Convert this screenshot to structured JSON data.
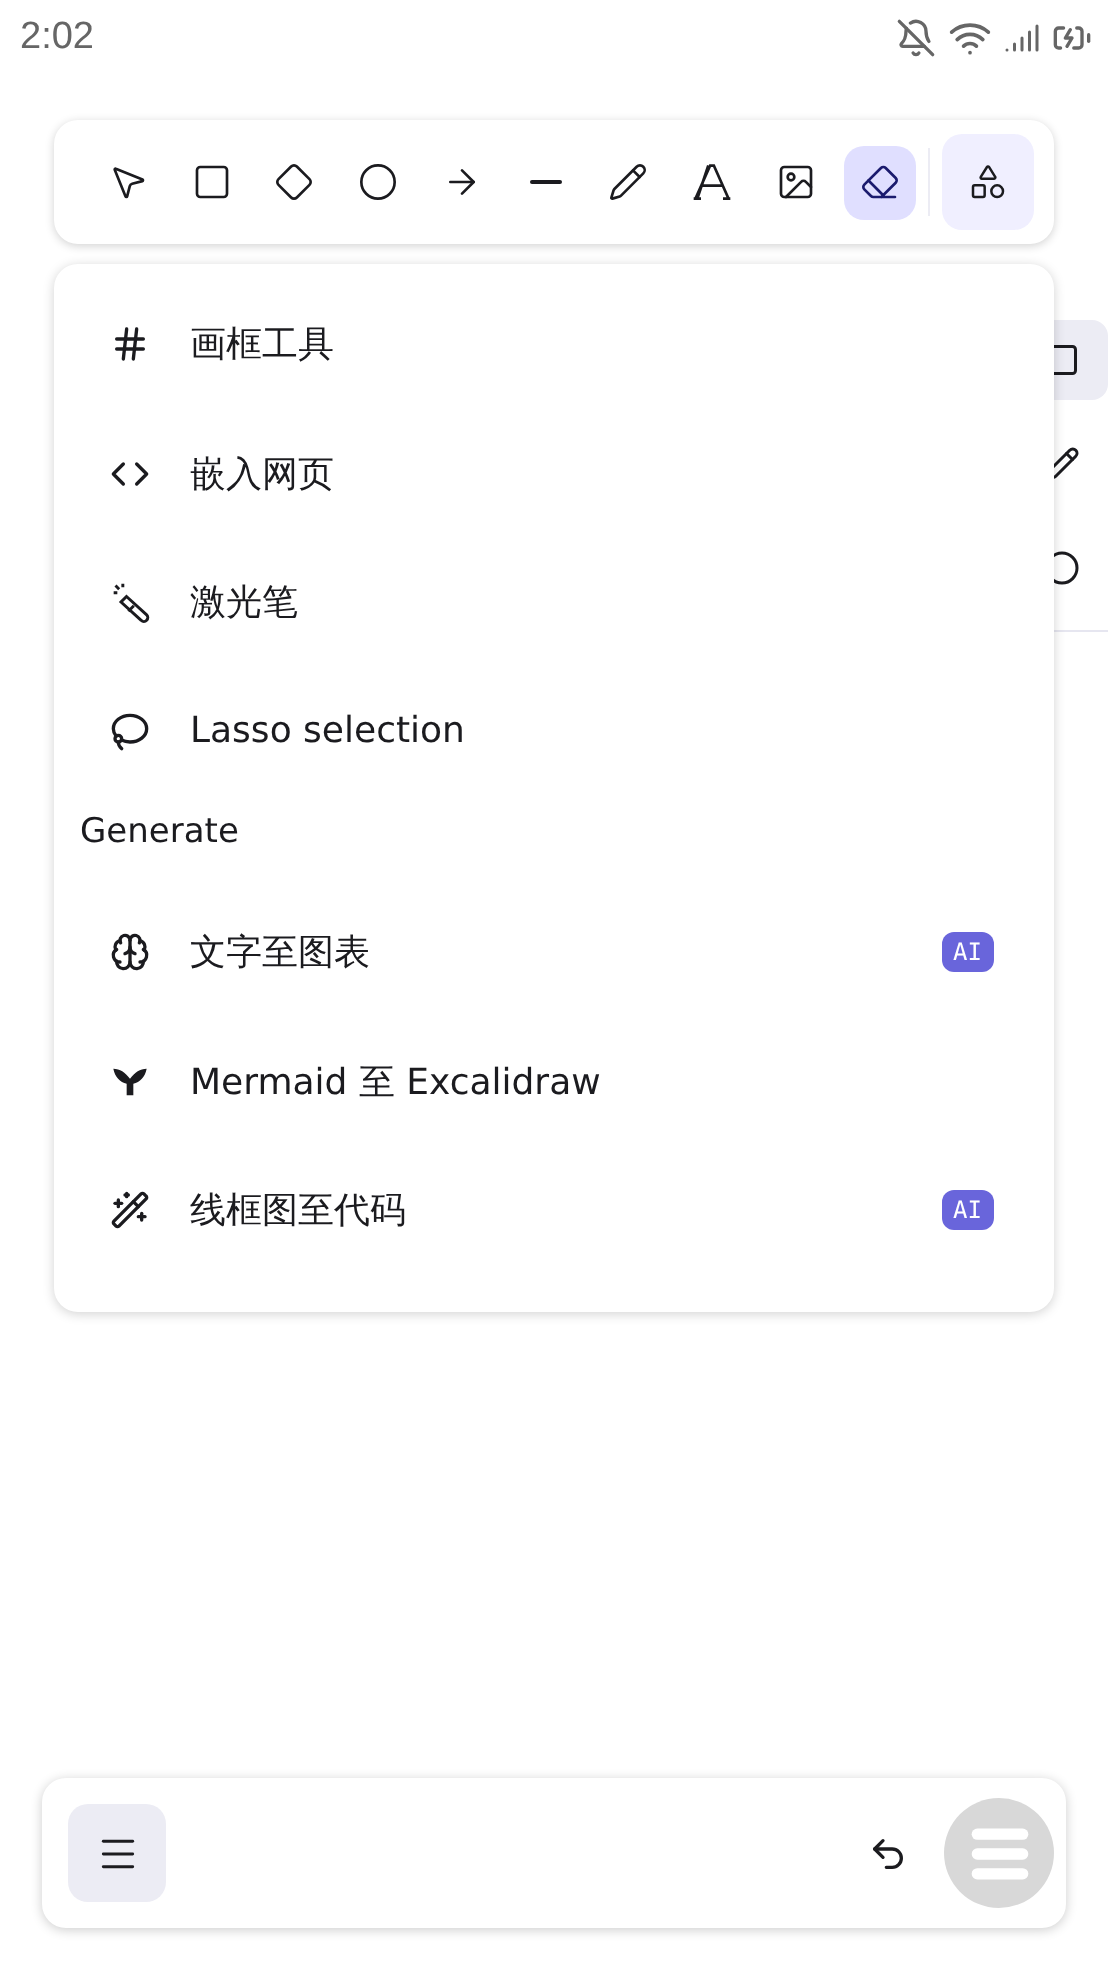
{
  "status_bar": {
    "time": "2:02"
  },
  "toolbar": {
    "tools": [
      {
        "kind": "selection",
        "selected": false
      },
      {
        "kind": "rectangle",
        "selected": false
      },
      {
        "kind": "diamond",
        "selected": false
      },
      {
        "kind": "ellipse",
        "selected": false
      },
      {
        "kind": "arrow",
        "selected": false
      },
      {
        "kind": "line",
        "selected": false
      },
      {
        "kind": "draw",
        "selected": false
      },
      {
        "kind": "text",
        "selected": false
      },
      {
        "kind": "image",
        "selected": false
      },
      {
        "kind": "eraser",
        "selected": true
      }
    ],
    "more_tools": {
      "expanded": true
    }
  },
  "menu": {
    "items": [
      {
        "kind": "frame",
        "label": "画框工具"
      },
      {
        "kind": "embed",
        "label": "嵌入网页"
      },
      {
        "kind": "laser",
        "label": "激光笔"
      },
      {
        "kind": "lasso",
        "label": "Lasso selection"
      }
    ],
    "section": "Generate",
    "generate_items": [
      {
        "kind": "brain",
        "label": "文字至图表",
        "badge": "AI"
      },
      {
        "kind": "mermaid",
        "label": "Mermaid 至 Excalidraw"
      },
      {
        "kind": "wand",
        "label": "线框图至代码",
        "badge": "AI"
      }
    ]
  }
}
